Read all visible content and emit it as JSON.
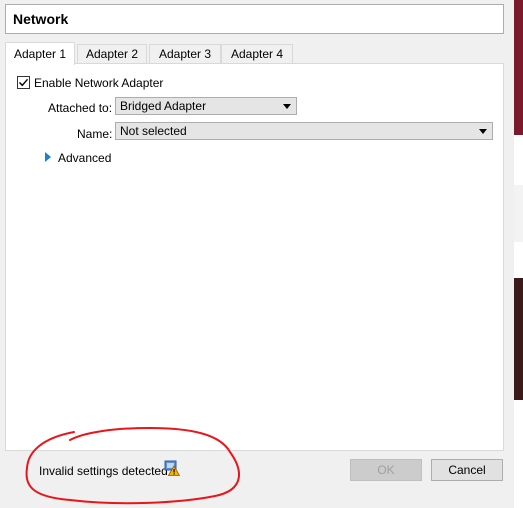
{
  "title": "Network",
  "tabs": [
    {
      "label": "Adapter 1",
      "active": true
    },
    {
      "label": "Adapter 2",
      "active": false
    },
    {
      "label": "Adapter 3",
      "active": false
    },
    {
      "label": "Adapter 4",
      "active": false
    }
  ],
  "enable_adapter": {
    "label": "Enable Network Adapter",
    "checked": true
  },
  "attached_to": {
    "label": "Attached to:",
    "value": "Bridged Adapter"
  },
  "name": {
    "label": "Name:",
    "value": "Not selected"
  },
  "advanced": {
    "label": "Advanced",
    "icon": "expand-arrow-icon"
  },
  "status": {
    "text": "Invalid settings detected",
    "icon": "warning-icon"
  },
  "buttons": {
    "ok": "OK",
    "cancel": "Cancel"
  },
  "colors": {
    "annotation": "#e8161b",
    "accent": "#1e7fd8"
  }
}
